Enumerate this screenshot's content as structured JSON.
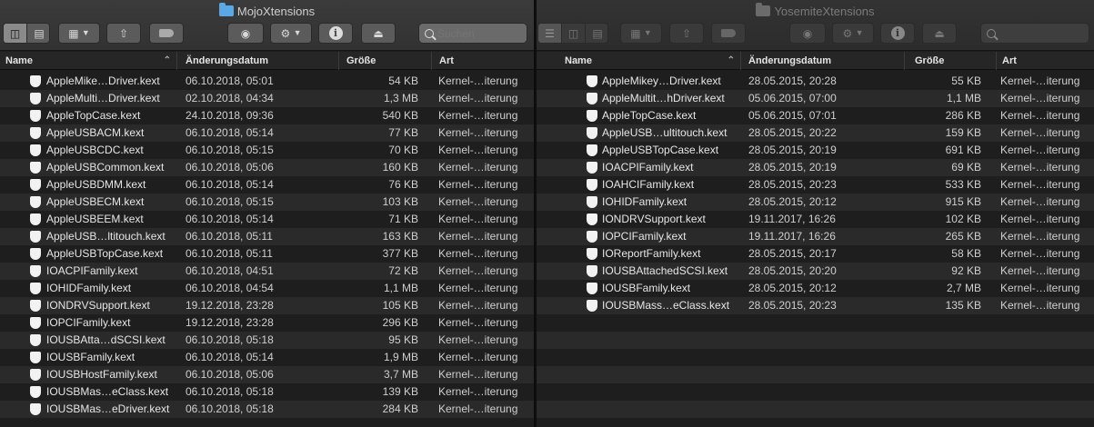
{
  "left_window": {
    "title": "MojoXtensions",
    "search_placeholder": "Suchen",
    "columns": {
      "name": "Name",
      "date": "Änderungsdatum",
      "size": "Größe",
      "kind": "Art"
    },
    "rows": [
      {
        "name": "AppleMike…Driver.kext",
        "date": "06.10.2018, 05:01",
        "size": "54 KB",
        "kind": "Kernel-…iterung"
      },
      {
        "name": "AppleMulti…Driver.kext",
        "date": "02.10.2018, 04:34",
        "size": "1,3 MB",
        "kind": "Kernel-…iterung"
      },
      {
        "name": "AppleTopCase.kext",
        "date": "24.10.2018, 09:36",
        "size": "540 KB",
        "kind": "Kernel-…iterung"
      },
      {
        "name": "AppleUSBACM.kext",
        "date": "06.10.2018, 05:14",
        "size": "77 KB",
        "kind": "Kernel-…iterung"
      },
      {
        "name": "AppleUSBCDC.kext",
        "date": "06.10.2018, 05:15",
        "size": "70 KB",
        "kind": "Kernel-…iterung"
      },
      {
        "name": "AppleUSBCommon.kext",
        "date": "06.10.2018, 05:06",
        "size": "160 KB",
        "kind": "Kernel-…iterung"
      },
      {
        "name": "AppleUSBDMM.kext",
        "date": "06.10.2018, 05:14",
        "size": "76 KB",
        "kind": "Kernel-…iterung"
      },
      {
        "name": "AppleUSBECM.kext",
        "date": "06.10.2018, 05:15",
        "size": "103 KB",
        "kind": "Kernel-…iterung"
      },
      {
        "name": "AppleUSBEEM.kext",
        "date": "06.10.2018, 05:14",
        "size": "71 KB",
        "kind": "Kernel-…iterung"
      },
      {
        "name": "AppleUSB…ltitouch.kext",
        "date": "06.10.2018, 05:11",
        "size": "163 KB",
        "kind": "Kernel-…iterung"
      },
      {
        "name": "AppleUSBTopCase.kext",
        "date": "06.10.2018, 05:11",
        "size": "377 KB",
        "kind": "Kernel-…iterung"
      },
      {
        "name": "IOACPIFamily.kext",
        "date": "06.10.2018, 04:51",
        "size": "72 KB",
        "kind": "Kernel-…iterung"
      },
      {
        "name": "IOHIDFamily.kext",
        "date": "06.10.2018, 04:54",
        "size": "1,1 MB",
        "kind": "Kernel-…iterung"
      },
      {
        "name": "IONDRVSupport.kext",
        "date": "19.12.2018, 23:28",
        "size": "105 KB",
        "kind": "Kernel-…iterung"
      },
      {
        "name": "IOPCIFamily.kext",
        "date": "19.12.2018, 23:28",
        "size": "296 KB",
        "kind": "Kernel-…iterung"
      },
      {
        "name": "IOUSBAtta…dSCSI.kext",
        "date": "06.10.2018, 05:18",
        "size": "95 KB",
        "kind": "Kernel-…iterung"
      },
      {
        "name": "IOUSBFamily.kext",
        "date": "06.10.2018, 05:14",
        "size": "1,9 MB",
        "kind": "Kernel-…iterung"
      },
      {
        "name": "IOUSBHostFamily.kext",
        "date": "06.10.2018, 05:06",
        "size": "3,7 MB",
        "kind": "Kernel-…iterung"
      },
      {
        "name": "IOUSBMas…eClass.kext",
        "date": "06.10.2018, 05:18",
        "size": "139 KB",
        "kind": "Kernel-…iterung"
      },
      {
        "name": "IOUSBMas…eDriver.kext",
        "date": "06.10.2018, 05:18",
        "size": "284 KB",
        "kind": "Kernel-…iterung"
      }
    ]
  },
  "right_window": {
    "title": "YosemiteXtensions",
    "search_placeholder": "",
    "columns": {
      "name": "Name",
      "date": "Änderungsdatum",
      "size": "Größe",
      "kind": "Art"
    },
    "rows": [
      {
        "name": "AppleMikey…Driver.kext",
        "date": "28.05.2015, 20:28",
        "size": "55 KB",
        "kind": "Kernel-…iterung"
      },
      {
        "name": "AppleMultit…hDriver.kext",
        "date": "05.06.2015, 07:00",
        "size": "1,1 MB",
        "kind": "Kernel-…iterung"
      },
      {
        "name": "AppleTopCase.kext",
        "date": "05.06.2015, 07:01",
        "size": "286 KB",
        "kind": "Kernel-…iterung"
      },
      {
        "name": "AppleUSB…ultitouch.kext",
        "date": "28.05.2015, 20:22",
        "size": "159 KB",
        "kind": "Kernel-…iterung"
      },
      {
        "name": "AppleUSBTopCase.kext",
        "date": "28.05.2015, 20:19",
        "size": "691 KB",
        "kind": "Kernel-…iterung"
      },
      {
        "name": "IOACPIFamily.kext",
        "date": "28.05.2015, 20:19",
        "size": "69 KB",
        "kind": "Kernel-…iterung"
      },
      {
        "name": "IOAHCIFamily.kext",
        "date": "28.05.2015, 20:23",
        "size": "533 KB",
        "kind": "Kernel-…iterung"
      },
      {
        "name": "IOHIDFamily.kext",
        "date": "28.05.2015, 20:12",
        "size": "915 KB",
        "kind": "Kernel-…iterung"
      },
      {
        "name": "IONDRVSupport.kext",
        "date": "19.11.2017, 16:26",
        "size": "102 KB",
        "kind": "Kernel-…iterung"
      },
      {
        "name": "IOPCIFamily.kext",
        "date": "19.11.2017, 16:26",
        "size": "265 KB",
        "kind": "Kernel-…iterung"
      },
      {
        "name": "IOReportFamily.kext",
        "date": "28.05.2015, 20:17",
        "size": "58 KB",
        "kind": "Kernel-…iterung"
      },
      {
        "name": "IOUSBAttachedSCSI.kext",
        "date": "28.05.2015, 20:20",
        "size": "92 KB",
        "kind": "Kernel-…iterung"
      },
      {
        "name": "IOUSBFamily.kext",
        "date": "28.05.2015, 20:12",
        "size": "2,7 MB",
        "kind": "Kernel-…iterung"
      },
      {
        "name": "IOUSBMass…eClass.kext",
        "date": "28.05.2015, 20:23",
        "size": "135 KB",
        "kind": "Kernel-…iterung"
      }
    ]
  },
  "icons": {
    "view_modes_left": [
      "icon-view-icon",
      "list-view-icon"
    ],
    "view_modes_right": [
      "list-view-icon",
      "column-view-icon",
      "gallery-view-icon"
    ],
    "group": "grid-icon",
    "share": "share-icon",
    "tag": "tag-icon",
    "quicklook": "eye-icon",
    "action": "gear-icon",
    "info": "info-icon",
    "eject": "eject-icon",
    "search": "search-icon",
    "file": "kext-icon"
  },
  "colors": {
    "folder_active": "#5aa9e6",
    "background": "#1e1e1e"
  }
}
